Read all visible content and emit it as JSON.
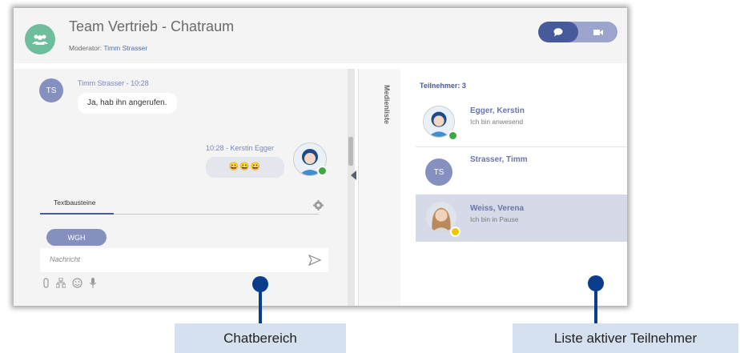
{
  "header": {
    "title": "Team Vertrieb - Chatraum",
    "moderator_label": "Moderator:",
    "moderator_name": "Timm Strasser",
    "toggle_left_icon": "chat-bubble-icon",
    "toggle_right_icon": "video-camera-icon"
  },
  "chat": {
    "messages": [
      {
        "initials": "TS",
        "meta": "Timm Strasser - 10:28",
        "text": "Ja, hab ihn angerufen.",
        "own": false
      },
      {
        "meta": "10:28 - Kerstin Egger",
        "text": "😀😀😀",
        "own": true
      }
    ],
    "tab_label": "Textbausteine",
    "quick_reply": "WGH",
    "message_placeholder": "Nachricht",
    "tools": [
      "paperclip-icon",
      "sitemap-icon",
      "emoji-icon",
      "microphone-icon"
    ]
  },
  "media": {
    "label": "Medienliste"
  },
  "participants": {
    "title": "Teilnehmer: 3",
    "items": [
      {
        "name": "Egger, Kerstin",
        "status": "Ich bin anwesend",
        "presence": "online",
        "selected": false
      },
      {
        "name": "Strasser, Timm",
        "status": "",
        "initials": "TS",
        "selected": false
      },
      {
        "name": "Weiss, Verena",
        "status": "Ich bin in Pause",
        "presence": "away",
        "selected": true
      }
    ]
  },
  "callouts": {
    "left": "Chatbereich",
    "right": "Liste aktiver Teilnehmer"
  },
  "colors": {
    "accent": "#475a9c",
    "online": "#3ea83e",
    "away": "#f2c400",
    "callout": "#0a3e8c"
  }
}
